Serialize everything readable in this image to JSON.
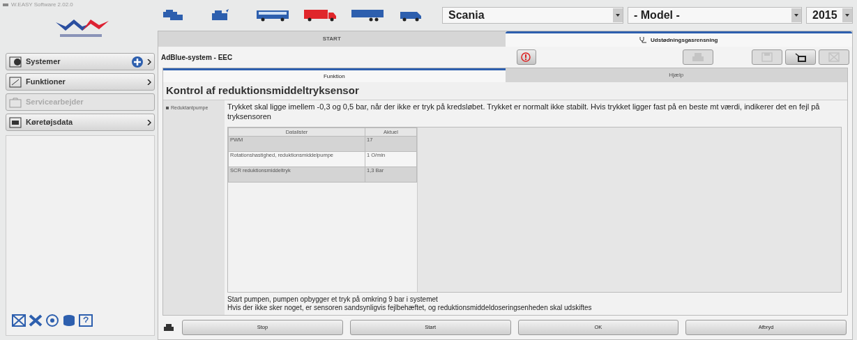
{
  "window": {
    "title": "W.EASY Software 2.02.0"
  },
  "vehicles": [
    {
      "kind": "cars",
      "selected": false
    },
    {
      "kind": "engine",
      "selected": false
    },
    {
      "kind": "bus",
      "selected": false
    },
    {
      "kind": "truck",
      "selected": true
    },
    {
      "kind": "trailer",
      "selected": false
    },
    {
      "kind": "van",
      "selected": false
    }
  ],
  "selectors": [
    {
      "value": "Scania"
    },
    {
      "value": "- Model -"
    },
    {
      "value": "2015"
    }
  ],
  "sidebar": {
    "items": [
      {
        "label": "Systemer",
        "kind": "systems",
        "disabled": false,
        "plus": true
      },
      {
        "label": "Funktioner",
        "kind": "functions",
        "disabled": false,
        "plus": false
      },
      {
        "label": "Servicearbejder",
        "kind": "service",
        "disabled": true,
        "plus": false
      },
      {
        "label": "Køretøjsdata",
        "kind": "vehicle-data",
        "disabled": false,
        "plus": false
      }
    ],
    "tools": [
      {
        "kind": "close"
      },
      {
        "kind": "tools"
      },
      {
        "kind": "disc"
      },
      {
        "kind": "database"
      },
      {
        "kind": "help"
      }
    ]
  },
  "tabs": [
    {
      "label": "START",
      "selected": false
    },
    {
      "label": "Udstødningsgasrensning",
      "selected": true
    }
  ],
  "breadcrumb": "AdBlue-system - EEC",
  "toolbar": [
    {
      "kind": "info",
      "disabled": false
    },
    {
      "kind": "print",
      "disabled": true
    },
    {
      "kind": "save",
      "disabled": true
    },
    {
      "kind": "window",
      "disabled": false
    },
    {
      "kind": "close",
      "disabled": true
    }
  ],
  "subtabs": [
    {
      "label": "Funktion",
      "selected": true
    },
    {
      "label": "Hjælp",
      "selected": false
    }
  ],
  "heading": "Kontrol af reduktionsmiddeltryksensor",
  "components": [
    {
      "label": "Reduktantpumpe",
      "selected": true
    }
  ],
  "description": "Trykket skal ligge imellem -0,3 og 0,5 bar, når der ikke er tryk på kredsløbet. Trykket er normalt ikke stabilt. Hvis trykket ligger fast på en beste mt værdi, indikerer det en fejl på tryksensoren",
  "table": {
    "columns": [
      "Datalister",
      "Aktuel"
    ],
    "rows": [
      [
        "PWM",
        "17"
      ],
      [
        "Rotationshastighed, reduktionsmiddelpumpe",
        "1 O/min"
      ],
      [
        "SCR reduktionsmiddeltryk",
        "1,3 Bar"
      ]
    ]
  },
  "instructions": [
    "Start pumpen, pumpen opbygger et tryk på omkring 9 bar i systemet",
    "Hvis der ikke sker noget, er sensoren sandsynligvis fejlbehæftet, og reduktionsmiddeldoseringsenheden skal udskiftes"
  ],
  "buttons": [
    "Stop",
    "Start",
    "OK",
    "Afbryd"
  ]
}
